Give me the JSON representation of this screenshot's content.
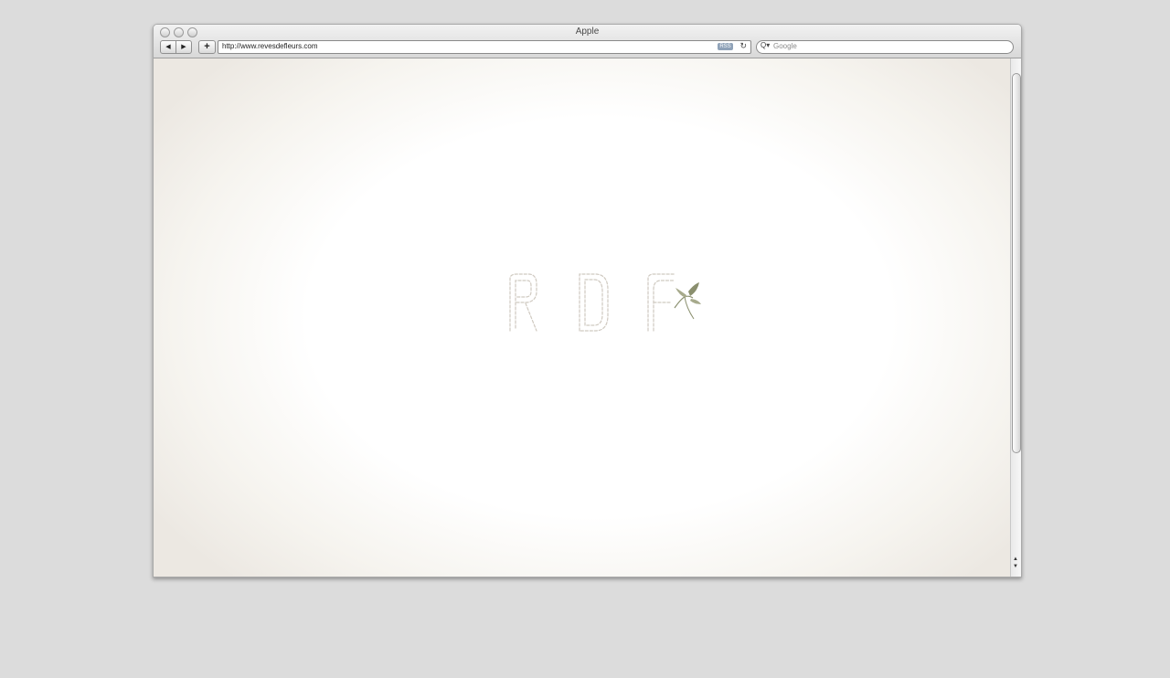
{
  "window": {
    "title": "Apple"
  },
  "toolbar": {
    "back_glyph": "◀",
    "forward_glyph": "▶",
    "add_glyph": "+",
    "url": "http://www.revesdefleurs.com",
    "rss_label": "RSS",
    "reload_glyph": "↻",
    "search_placeholder": "Google",
    "search_glyph": "Q▾"
  },
  "page": {
    "logo_text": "RDF",
    "accent_color": "#8a8f6e"
  },
  "scrollbar": {
    "up_glyph": "▲",
    "down_glyph": "▼"
  }
}
